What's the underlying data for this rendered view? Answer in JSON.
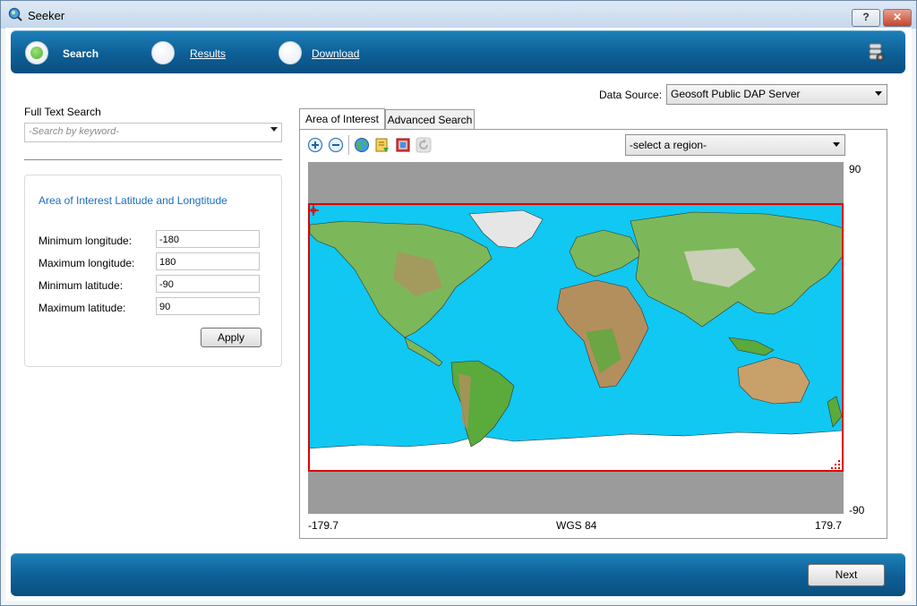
{
  "window": {
    "title": "Seeker",
    "help_label": "?",
    "close_label": "✕"
  },
  "wizard": {
    "steps": [
      {
        "label": "Search",
        "state": "active"
      },
      {
        "label": "Results",
        "state": "link"
      },
      {
        "label": "Download",
        "state": "link"
      }
    ],
    "server_icon": "database-settings-icon"
  },
  "search": {
    "label": "Full Text Search",
    "placeholder": "-Search by keyword-"
  },
  "aoi_group": {
    "title": "Area of Interest Latitude and Longtitude",
    "fields": [
      {
        "label": "Minimum longitude:",
        "value": "-180"
      },
      {
        "label": "Maximum longitude:",
        "value": "180"
      },
      {
        "label": "Minimum latitude:",
        "value": "-90"
      },
      {
        "label": "Maximum latitude:",
        "value": "90"
      }
    ],
    "apply_label": "Apply"
  },
  "data_source": {
    "label": "Data Source:",
    "value": "Geosoft Public DAP Server"
  },
  "tabs": [
    {
      "label": "Area of Interest",
      "active": true
    },
    {
      "label": "Advanced Search",
      "active": false
    }
  ],
  "map_tools": [
    "zoom-in-icon",
    "zoom-out-icon",
    "globe-icon",
    "bookmark-add-icon",
    "select-area-icon",
    "refresh-icon"
  ],
  "region_select": {
    "value": "-select a region-"
  },
  "map": {
    "top_label": "90",
    "bottom_label": "-90",
    "left_label": "-179.7",
    "center_label": "WGS 84",
    "right_label": "179.7",
    "colors": {
      "ocean": "#10c8f2",
      "border": "#e00000",
      "background": "#9b9b9b"
    }
  },
  "footer": {
    "next_label": "Next"
  }
}
